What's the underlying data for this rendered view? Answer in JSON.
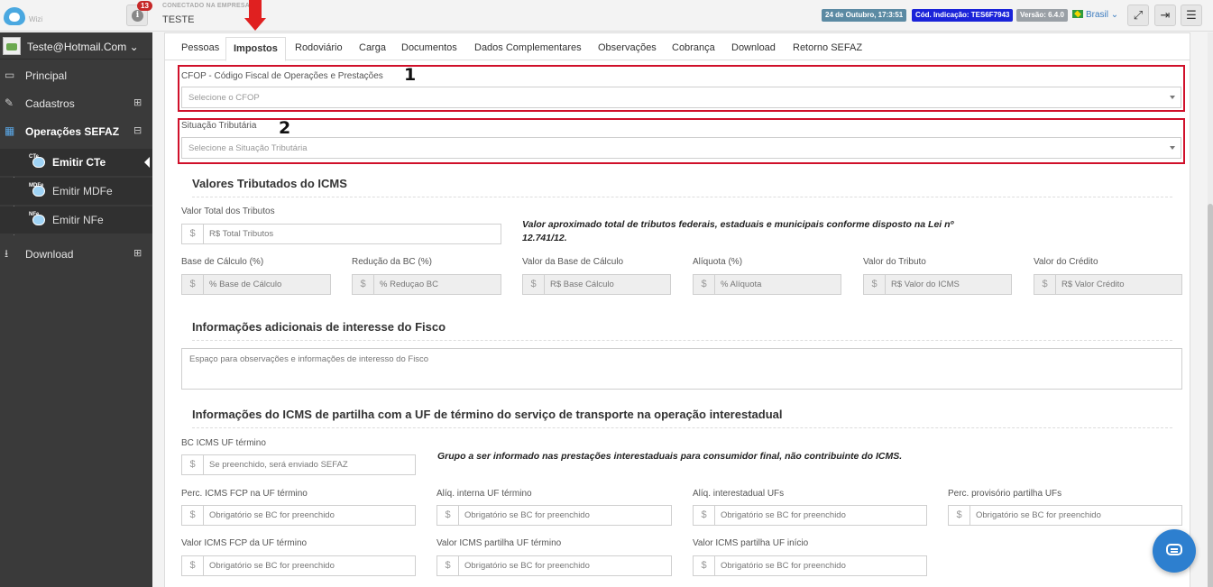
{
  "header": {
    "logo_text": "Wizi",
    "notifications_count": "13",
    "company_caption": "CONECTADO NA EMPRESA",
    "company_name": "TESTE",
    "date_tag": "24 de Outubro, 17:3:51",
    "code_tag": "Cód. Indicação: TES6F7943",
    "version_tag": "Versão: 6.4.0",
    "language": "Brasil"
  },
  "sidebar": {
    "user": "Teste@Hotmail.Com",
    "items": [
      {
        "label": "Principal"
      },
      {
        "label": "Cadastros"
      },
      {
        "label": "Operações SEFAZ"
      },
      {
        "label": "Download"
      }
    ],
    "sub_items": [
      {
        "label": "Emitir CTe",
        "icon_text": "CTe"
      },
      {
        "label": "Emitir MDFe",
        "icon_text": "MDFe"
      },
      {
        "label": "Emitir NFe",
        "icon_text": "NFe"
      }
    ]
  },
  "tabs": [
    "Pessoas",
    "Impostos",
    "Rodoviário",
    "Carga",
    "Documentos",
    "Dados Complementares",
    "Observações",
    "Cobrança",
    "Download",
    "Retorno SEFAZ"
  ],
  "active_tab": "Impostos",
  "cfop": {
    "label": "CFOP - Código Fiscal de Operações e Prestações",
    "placeholder": "Selecione o CFOP",
    "marker": "1"
  },
  "situacao": {
    "label": "Situação Tributária",
    "placeholder": "Selecione a Situação Tributária",
    "marker": "2"
  },
  "icms": {
    "title": "Valores Tributados do ICMS",
    "total_label": "Valor Total dos Tributos",
    "total_placeholder": "R$ Total Tributos",
    "note": "Valor aproximado total de tributos federais, estaduais e municipais conforme disposto na Lei nº 12.741/12.",
    "fields": [
      {
        "label": "Base de Cálculo (%)",
        "placeholder": "% Base de Cálculo"
      },
      {
        "label": "Redução da BC (%)",
        "placeholder": "% Reduçao BC"
      },
      {
        "label": "Valor da Base de Cálculo",
        "placeholder": "R$ Base Cálculo"
      },
      {
        "label": "Alíquota (%)",
        "placeholder": "% Alíquota"
      },
      {
        "label": "Valor do Tributo",
        "placeholder": "R$ Valor do ICMS"
      },
      {
        "label": "Valor do Crédito",
        "placeholder": "R$ Valor Crédito"
      }
    ]
  },
  "fisco": {
    "title": "Informações adicionais de interesse do Fisco",
    "placeholder": "Espaço para observações e informações de interesso do Fisco"
  },
  "partilha": {
    "title": "Informações do ICMS de partilha com a UF de término do serviço de transporte na operação interestadual",
    "bc_label": "BC ICMS UF término",
    "bc_placeholder": "Se preenchido, será enviado SEFAZ",
    "note": "Grupo a ser informado nas prestações interestaduais para consumidor final, não contribuinte do ICMS.",
    "row1": [
      {
        "label": "Perc. ICMS FCP na UF término",
        "placeholder": "Obrigatório se BC for preenchido"
      },
      {
        "label": "Alíq. interna UF término",
        "placeholder": "Obrigatório se BC for preenchido"
      },
      {
        "label": "Alíq. interestadual UFs",
        "placeholder": "Obrigatório se BC for preenchido"
      },
      {
        "label": "Perc. provisório partilha UFs",
        "placeholder": "Obrigatório se BC for preenchido"
      }
    ],
    "row2": [
      {
        "label": "Valor ICMS FCP da UF término",
        "placeholder": "Obrigatório se BC for preenchido"
      },
      {
        "label": "Valor ICMS partilha UF término",
        "placeholder": "Obrigatório se BC for preenchido"
      },
      {
        "label": "Valor ICMS partilha UF início",
        "placeholder": "Obrigatório se BC for preenchido"
      }
    ]
  },
  "currency_symbol": "$"
}
